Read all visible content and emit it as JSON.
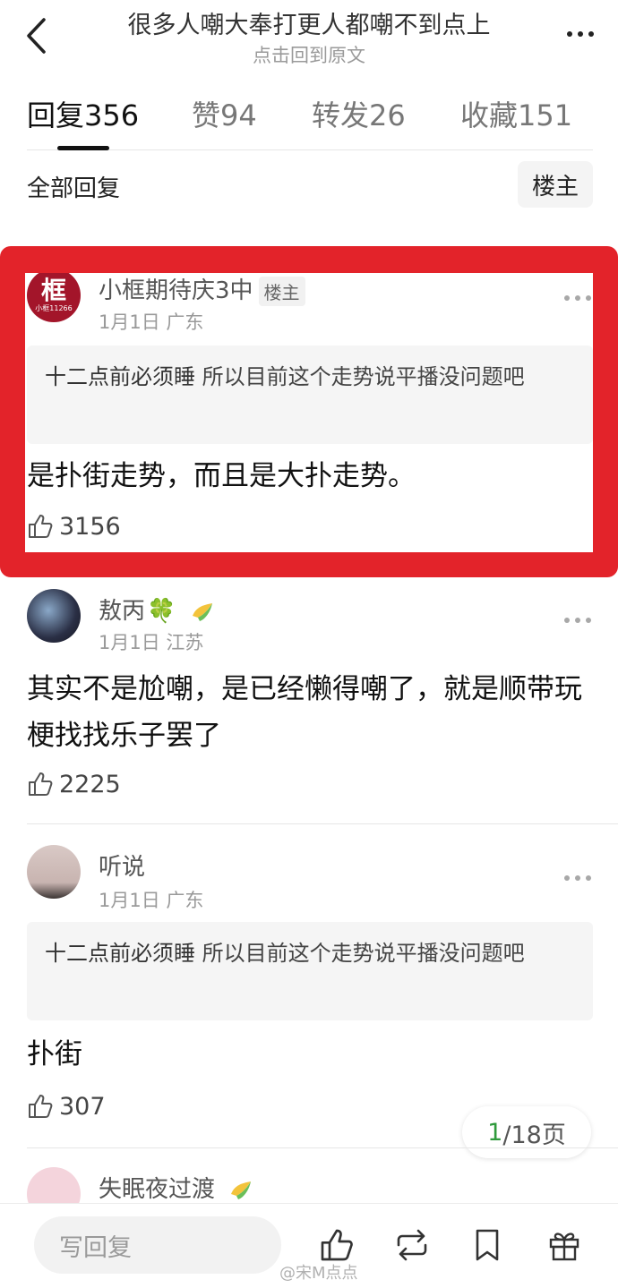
{
  "header": {
    "title": "很多人嘲大奉打更人都嘲不到点上",
    "subtitle": "点击回到原文"
  },
  "tabs": [
    {
      "label": "回复",
      "count": "356"
    },
    {
      "label": "赞",
      "count": "94"
    },
    {
      "label": "转发",
      "count": "26"
    },
    {
      "label": "收藏",
      "count": "151"
    }
  ],
  "filter": {
    "label": "全部回复",
    "owner_button": "楼主"
  },
  "comments": [
    {
      "avatar_text": "框",
      "avatar_sub": "小框11266",
      "name": "小框期待庆3中",
      "badge": "楼主",
      "meta": "1月1日 广东",
      "quote_user": "十二点前必须睡",
      "quote_text": " 所以目前这个走势说平播没问题吧",
      "text": "是扑街走势，而且是大扑走势。",
      "likes": "3156"
    },
    {
      "name": "敖丙",
      "name_emoji": "🍀",
      "meta": "1月1日 江苏",
      "text": "其实不是尬嘲，是已经懒得嘲了，就是顺带玩梗找找乐子罢了",
      "likes": "2225"
    },
    {
      "name": "听说",
      "meta": "1月1日 广东",
      "quote_user": "十二点前必须睡",
      "quote_text": " 所以目前这个走势说平播没问题吧",
      "text": "扑街",
      "likes": "307"
    },
    {
      "name": "失眠夜过渡"
    }
  ],
  "page_indicator": {
    "current": "1",
    "rest": "/18页"
  },
  "bottom_bar": {
    "reply_placeholder": "写回复",
    "watermark": "@宋M点点"
  },
  "colors": {
    "highlight": "#e3232a",
    "page_current": "#2f9a3c"
  }
}
